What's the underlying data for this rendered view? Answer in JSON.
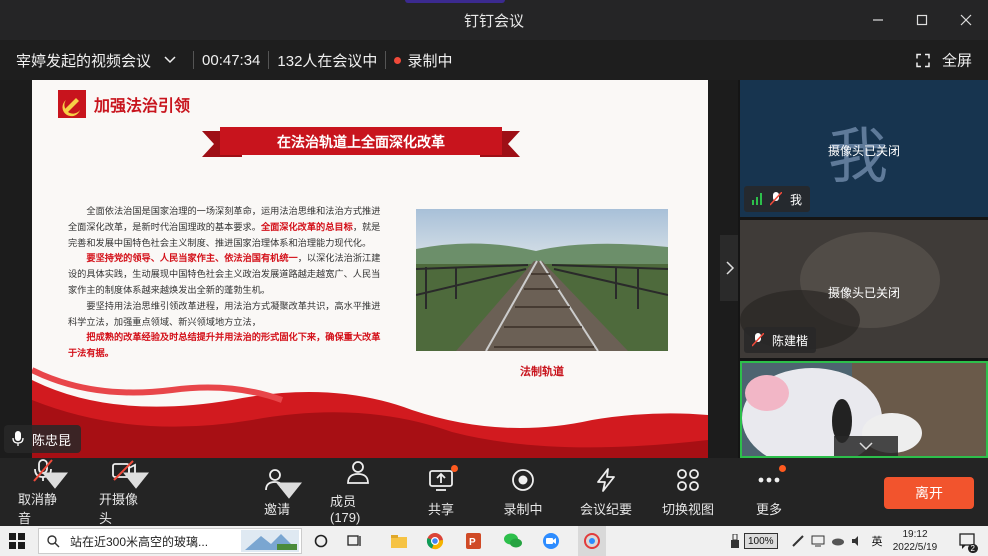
{
  "window": {
    "title": "钉钉会议"
  },
  "infobar": {
    "meeting_name": "宰婷发起的视频会议",
    "duration": "00:47:34",
    "participants_text": "132人在会议中",
    "recording_text": "录制中",
    "fullscreen_label": "全屏"
  },
  "slide": {
    "heading": "加强法治引领",
    "ribbon_title": "在法治轨道上全面深化改革",
    "paragraphs": [
      {
        "parts": [
          {
            "text": "全面依法治国是国家治理的一场深刻革命，运用法治思维和法治方式推进全面深化改革，是新时代治国理政的基本要求。",
            "red": false
          },
          {
            "text": "全面深化改革的总目标",
            "red": true
          },
          {
            "text": "，就是完善和发展中国特色社会主义制度、推进国家治理体系和治理能力现代化。",
            "red": false
          }
        ]
      },
      {
        "parts": [
          {
            "text": "要坚持党的领导、人民当家作主、依法治国有机统一",
            "red": true
          },
          {
            "text": "，以深化法治浙江建设的具体实践，生动展现中国特色社会主义政治发展道路越走越宽广、人民当家作主的制度体系越来越焕发出全新的蓬勃生机。",
            "red": false
          }
        ]
      },
      {
        "parts": [
          {
            "text": "要坚持用法治思维引领改革进程，用法治方式凝聚改革共识，高水平推进科学立法，加强重点领域、新兴领域地方立法，",
            "red": false
          }
        ]
      },
      {
        "parts": [
          {
            "text": "把成熟的改革经验及时总结提升并用法治的形式固化下来，确保重大改革于法有据。",
            "red": true
          }
        ]
      }
    ],
    "photo_caption": "法制轨道"
  },
  "speaker": {
    "name": "陈忠昆"
  },
  "participants": [
    {
      "avatar_char": "我",
      "status": "摄像头已关闭",
      "name": "我"
    },
    {
      "status": "摄像头已关闭",
      "name": "陈建楷"
    },
    {
      "status": ""
    }
  ],
  "toolbar": {
    "mute": "取消静音",
    "camera": "开摄像头",
    "invite": "邀请",
    "members": "成员(179)",
    "share": "共享",
    "recording": "录制中",
    "minutes": "会议纪要",
    "switch_view": "切换视图",
    "more": "更多",
    "leave": "离开"
  },
  "taskbar": {
    "search_text": "站在近300米高空的玻璃...",
    "battery": "100%",
    "ime": "英",
    "time": "19:12",
    "date": "2022/5/19",
    "notification_count": "2"
  },
  "colors": {
    "accent_red": "#c8141d",
    "leave_button": "#f2542d",
    "active_speaker_border": "#2dbf4b",
    "recording_dot": "#f04a3a"
  }
}
